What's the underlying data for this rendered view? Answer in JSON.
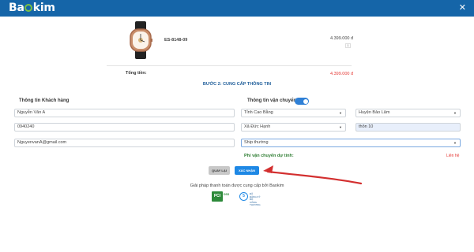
{
  "header": {
    "logo_text": "Baokim",
    "close_icon": "✕",
    "bg_color": "#1565a8"
  },
  "product": {
    "sku": "ES-8148-09",
    "price": "4.399.000 đ",
    "quantity": "1",
    "image_icon": "wristwatch-icon"
  },
  "summary": {
    "total_label": "Tổng tiền:",
    "total_value": "4.399.000 đ"
  },
  "step_title": "BƯỚC 2: CUNG CẤP THÔNG TIN",
  "customer": {
    "section_title": "Thông tin Khách hàng",
    "name_value": "Nguyễn Văn A",
    "phone_value": "0940240",
    "email_value": "NguyenvanA@gmail.com"
  },
  "shipping": {
    "section_title": "Thông tin vận chuyển",
    "toggle_on": true,
    "province_value": "Tỉnh Cao Bằng",
    "district_value": "Huyện Bảo Lâm",
    "ward_value": "Xã Đức Hạnh",
    "address_value": "thôn 10",
    "method_value": "Ship thường",
    "fee_label": "Phí vận chuyển dự tính:",
    "contact_label": "Liên hệ"
  },
  "actions": {
    "back_label": "QUAY LẠI",
    "confirm_label": "XÁC NHẬN"
  },
  "footer": {
    "provider_text": "Giải pháp thanh toán được cung cấp bởi Baokim",
    "pci_badge": "PCI",
    "pci_subtext": "DSS",
    "gov_badge": "5",
    "gov_subtext_1": "ĐÃ ĐĂNG KÝ",
    "gov_subtext_2": "BỘ CÔNG THƯƠNG"
  },
  "colors": {
    "accent_blue": "#1e88e5",
    "price_red": "#e53935",
    "fee_green": "#2e7d32",
    "arrow_red": "#d32f2f"
  }
}
